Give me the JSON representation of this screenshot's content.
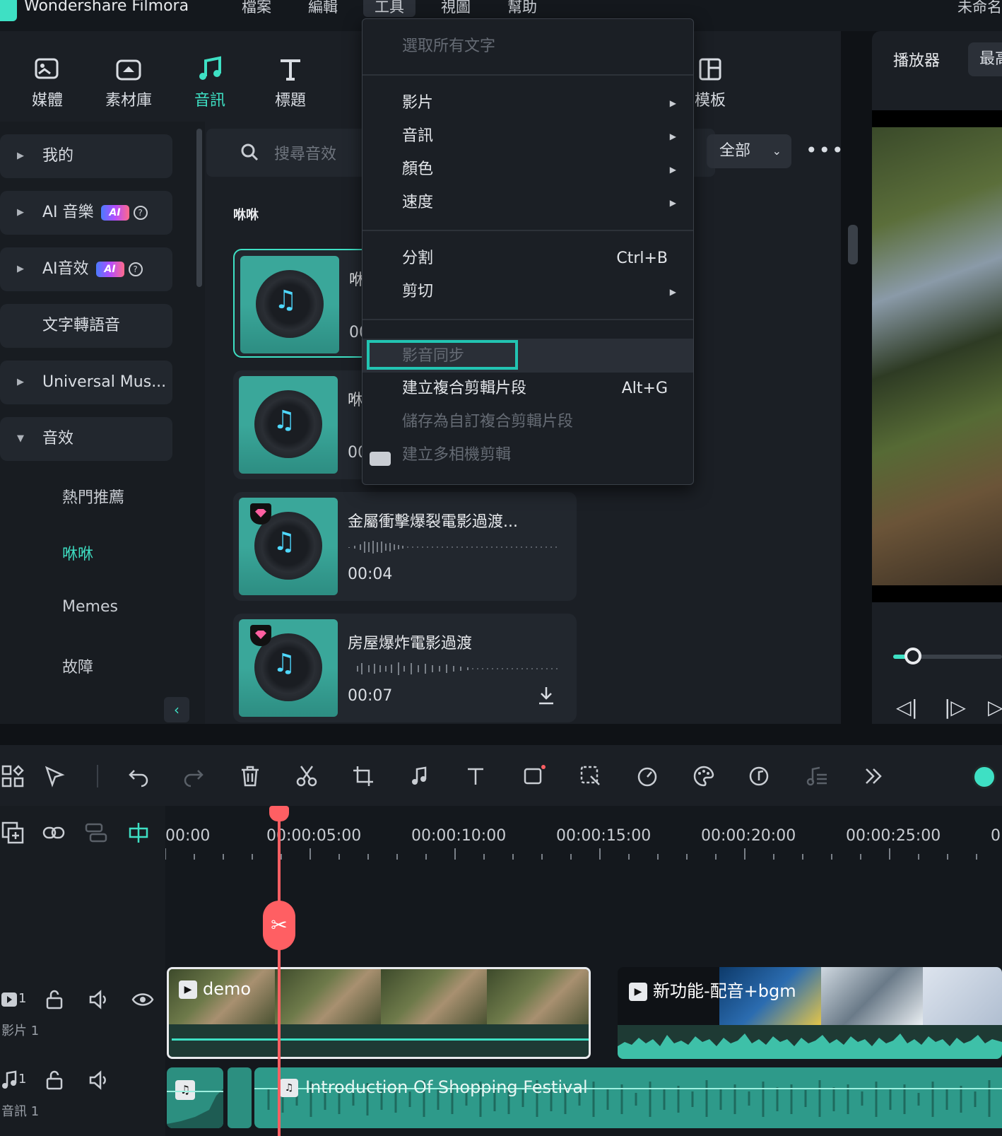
{
  "app": {
    "title": "Wondershare Filmora",
    "top_right": "未命名"
  },
  "menubar": {
    "file": "檔案",
    "edit": "編輯",
    "tools": "工具",
    "view": "視圖",
    "help": "幫助"
  },
  "tabs": [
    {
      "label": "媒體",
      "icon": "media-icon"
    },
    {
      "label": "素材庫",
      "icon": "stock-icon"
    },
    {
      "label": "音訊",
      "icon": "music-note-icon"
    },
    {
      "label": "標題",
      "icon": "text-icon"
    },
    {
      "label": "模板",
      "icon": "template-icon"
    }
  ],
  "sidebar": {
    "items": [
      {
        "label": "我的"
      },
      {
        "label": "AI 音樂"
      },
      {
        "label": "AI音效"
      },
      {
        "label": "文字轉語音"
      },
      {
        "label": "Universal Mus..."
      },
      {
        "label": "音效"
      }
    ],
    "ai_badge": "AI",
    "sub_items": [
      {
        "label": "熱門推薦"
      },
      {
        "label": "咻咻"
      },
      {
        "label": "Memes"
      },
      {
        "label": "故障"
      }
    ]
  },
  "content": {
    "search_placeholder": "搜尋音效",
    "filter_value": "全部",
    "section_label": "咻咻",
    "cards": [
      {
        "title": "咻",
        "duration": "00"
      },
      {
        "title": "咻",
        "duration": "00"
      },
      {
        "title": "金屬衝擊爆裂電影過渡...",
        "duration": "00:04"
      },
      {
        "title": "房屋爆炸電影過渡",
        "duration": "00:07"
      }
    ]
  },
  "dropdown": {
    "select_all_text": "選取所有文字",
    "video": "影片",
    "audio": "音訊",
    "color": "顏色",
    "speed": "速度",
    "split": "分割",
    "split_shortcut": "Ctrl+B",
    "cut": "剪切",
    "av_sync": "影音同步",
    "create_compound": "建立複合剪輯片段",
    "create_compound_shortcut": "Alt+G",
    "save_custom_compound": "儲存為自訂複合剪輯片段",
    "create_multicam": "建立多相機剪輯"
  },
  "player": {
    "tab": "播放器",
    "tab2": "最高"
  },
  "timeline": {
    "ruler": [
      "00:00",
      "00:00:05:00",
      "00:00:10:00",
      "00:00:15:00",
      "00:00:20:00",
      "00:00:25:00",
      "0"
    ],
    "video_track": {
      "number": "1",
      "name": "影片 1"
    },
    "audio_track": {
      "number": "1",
      "name": "音訊 1"
    },
    "clips": {
      "demo": "demo",
      "new_feature": "新功能-配音+bgm",
      "audio": "Introduction Of Shopping Festival"
    }
  },
  "colors": {
    "accent": "#3ee0c4",
    "playhead": "#ff5f63",
    "background": "#1b1f25"
  }
}
